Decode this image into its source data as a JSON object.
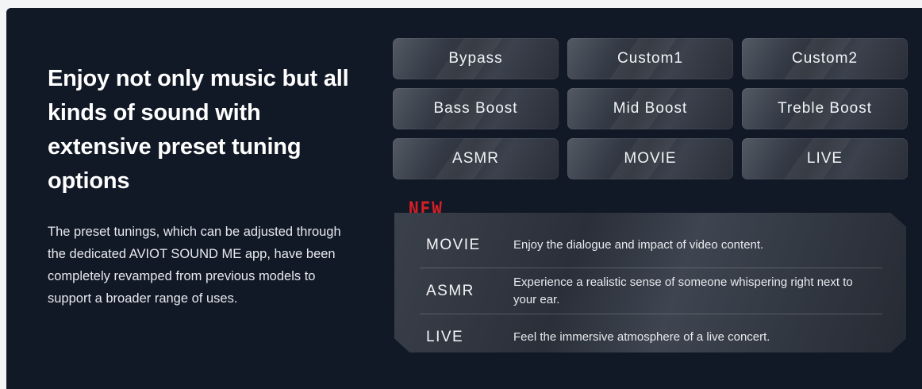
{
  "headline": "Enjoy not only music but all kinds of sound with extensive preset tuning options",
  "description": "The preset tunings, which can be adjusted through the dedicated AVIOT SOUND ME app, have been completely revamped from previous models to support a broader range of uses.",
  "presets": [
    "Bypass",
    "Custom1",
    "Custom2",
    "Bass Boost",
    "Mid Boost",
    "Treble Boost",
    "ASMR",
    "MOVIE",
    "LIVE"
  ],
  "new_section": {
    "badge": "NEW",
    "items": [
      {
        "name": "MOVIE",
        "desc": "Enjoy the dialogue and impact of video content."
      },
      {
        "name": "ASMR",
        "desc": "Experience a realistic sense of someone whispering right next to your ear."
      },
      {
        "name": "LIVE",
        "desc": "Feel the immersive atmosphere of a live concert."
      }
    ]
  },
  "colors": {
    "background": "#111826",
    "accent": "#d31f26",
    "text": "#ffffff"
  }
}
